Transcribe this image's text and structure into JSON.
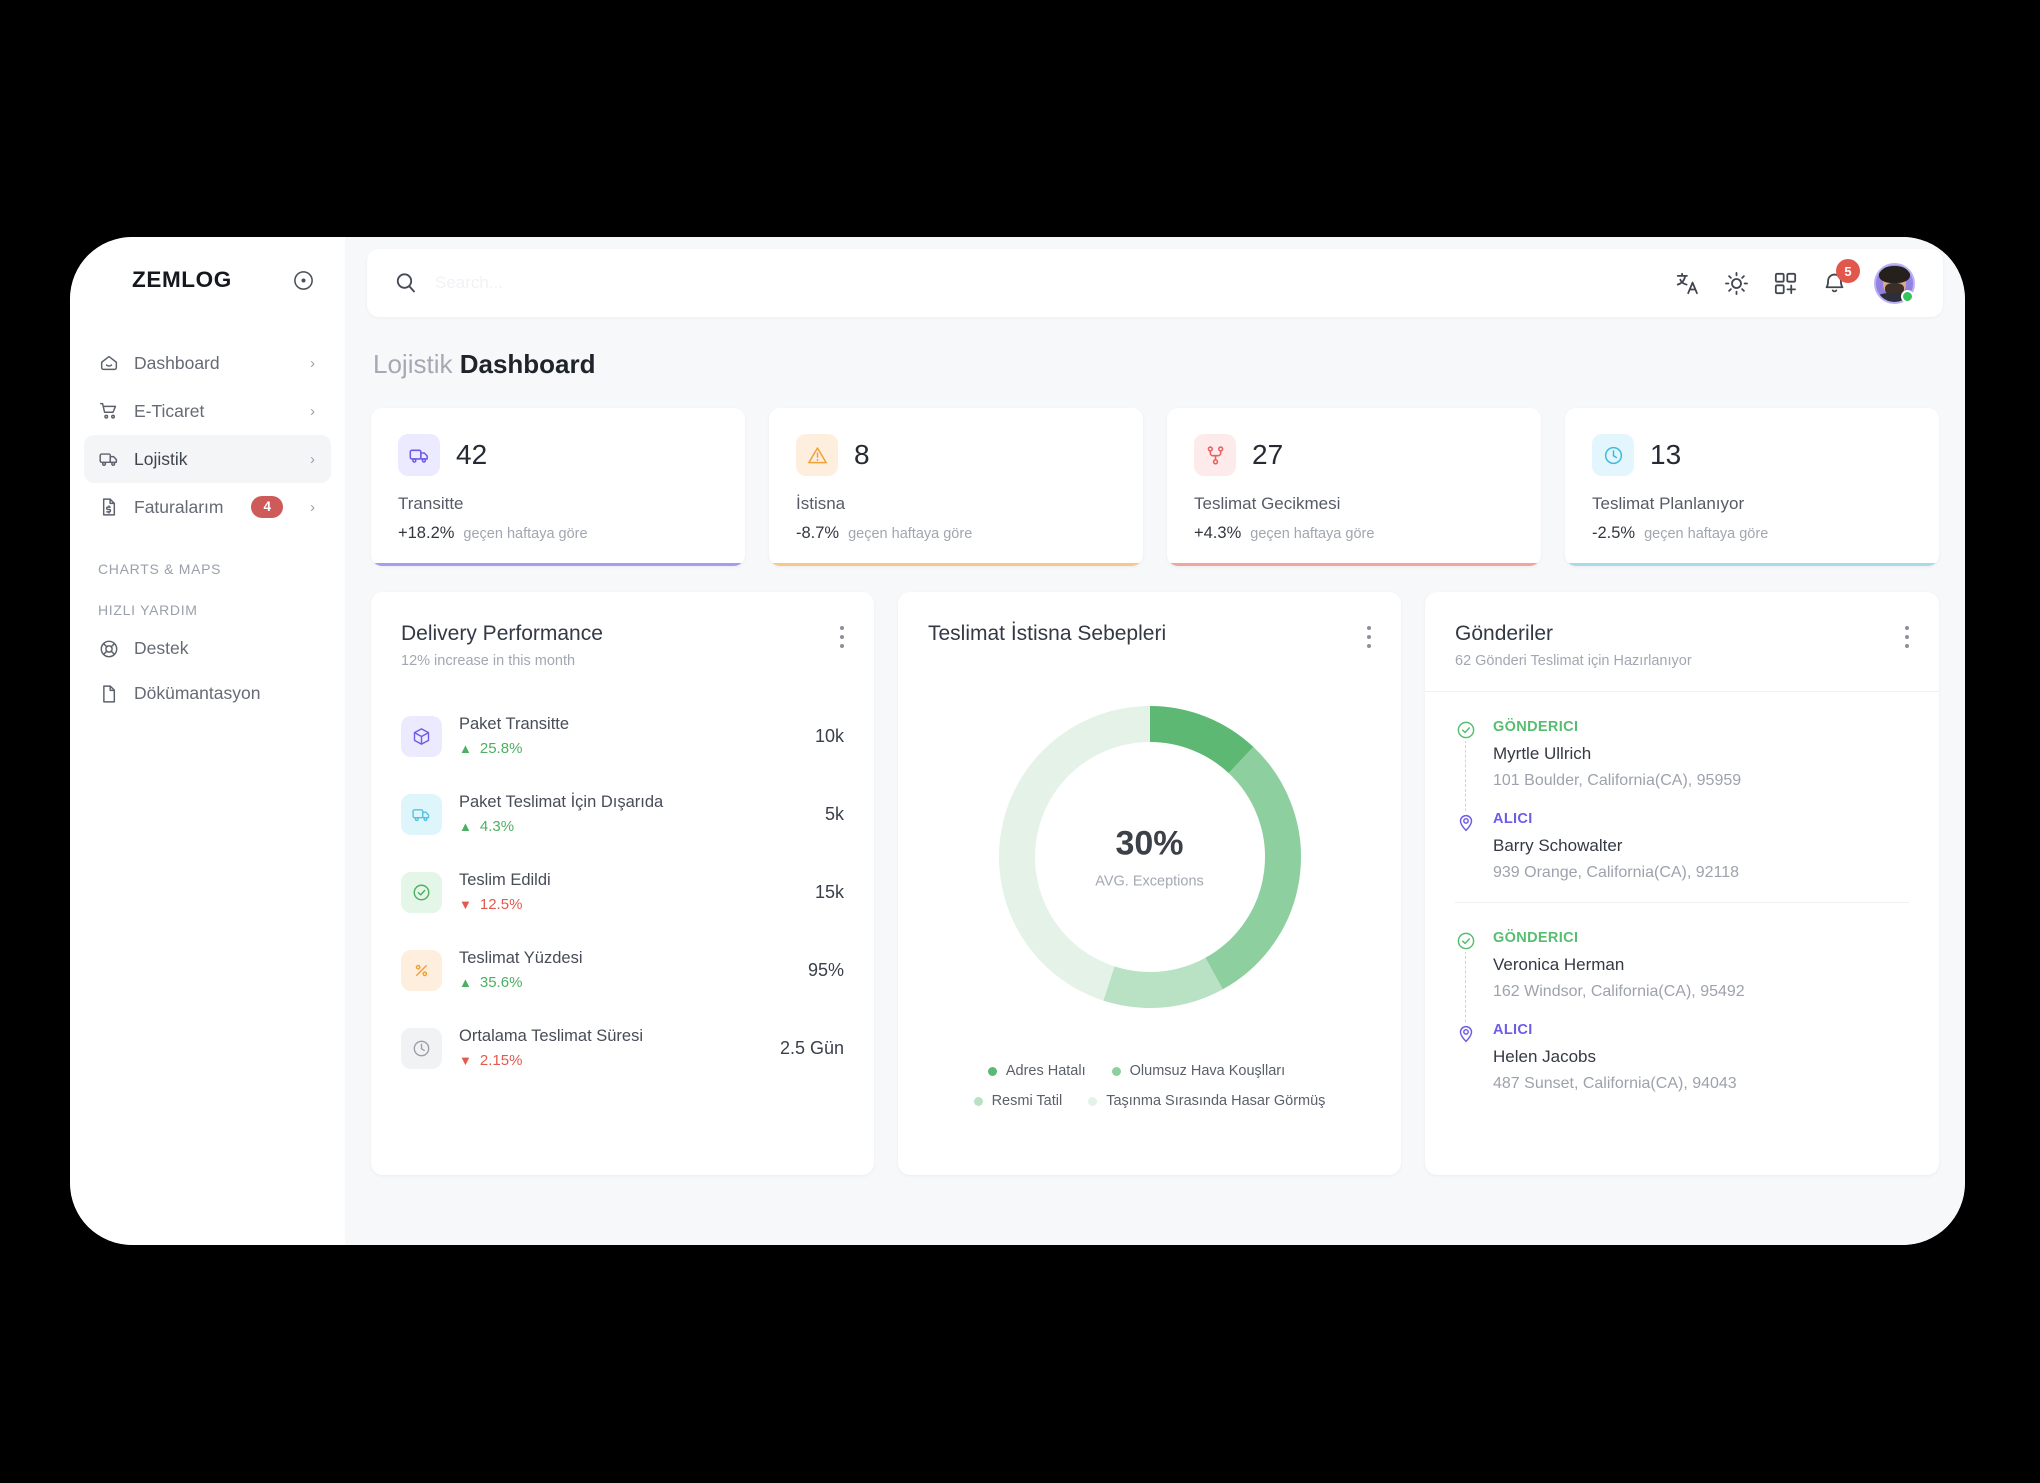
{
  "brand": {
    "name": "ZEMLOG",
    "logo_icon": "target-dot-icon"
  },
  "sidebar": {
    "items": [
      {
        "label": "Dashboard",
        "icon": "home-icon",
        "badge": null,
        "active": false
      },
      {
        "label": "E-Ticaret",
        "icon": "shopping-cart-icon",
        "badge": null,
        "active": false
      },
      {
        "label": "Lojistik",
        "icon": "truck-icon",
        "badge": null,
        "active": true
      },
      {
        "label": "Faturalarım",
        "icon": "invoice-icon",
        "badge": "4",
        "active": false
      }
    ],
    "section_charts": "CHARTS & MAPS",
    "section_help": "HIZLI YARDIM",
    "help_items": [
      {
        "label": "Destek",
        "icon": "lifebuoy-icon"
      },
      {
        "label": "Dökümantasyon",
        "icon": "document-icon"
      }
    ]
  },
  "topbar": {
    "search_placeholder": "Search...",
    "search_value": "",
    "icons": [
      "translate-icon",
      "sun-icon",
      "apps-add-icon",
      "bell-icon"
    ],
    "notification_count": "5",
    "avatar_status": "online"
  },
  "page": {
    "title_muted": "Lojistik",
    "title_strong": "Dashboard"
  },
  "kpi_cards": [
    {
      "value": "42",
      "label": "Transitte",
      "delta": "+18.2%",
      "delta_note": "geçen haftaya göre",
      "icon": "truck-icon",
      "badge_bg": "#eceaff",
      "icon_color": "#6c5ce7",
      "accent": "#a79bf0"
    },
    {
      "value": "8",
      "label": "İstisna",
      "delta": "-8.7%",
      "delta_note": "geçen haftaya göre",
      "icon": "warning-triangle-icon",
      "badge_bg": "#fdeedd",
      "icon_color": "#f0a13c",
      "accent": "#f5c98a"
    },
    {
      "value": "27",
      "label": "Teslimat Gecikmesi",
      "delta": "+4.3%",
      "delta_note": "geçen haftaya göre",
      "icon": "branch-icon",
      "badge_bg": "#fdeaea",
      "icon_color": "#ea5f5f",
      "accent": "#f0a6a0"
    },
    {
      "value": "13",
      "label": "Teslimat Planlanıyor",
      "delta": "-2.5%",
      "delta_note": "geçen haftaya göre",
      "icon": "clock-icon",
      "badge_bg": "#e3f6fd",
      "icon_color": "#42b9de",
      "accent": "#a6dbec"
    }
  ],
  "delivery_performance": {
    "title": "Delivery Performance",
    "subtitle": "12% increase in this month",
    "menu_icon": "kebab-menu-icon",
    "rows": [
      {
        "name": "Paket Transitte",
        "change": "25.8%",
        "direction": "up",
        "value": "10k",
        "icon": "package-icon",
        "badge_bg": "#eceaff",
        "icon_color": "#6c5ce7"
      },
      {
        "name": "Paket Teslimat İçin Dışarıda",
        "change": "4.3%",
        "direction": "up",
        "value": "5k",
        "icon": "truck-icon",
        "badge_bg": "#ddf5fb",
        "icon_color": "#56c2dd"
      },
      {
        "name": "Teslim Edildi",
        "change": "12.5%",
        "direction": "down",
        "value": "15k",
        "icon": "check-circle-icon",
        "badge_bg": "#e4f6e7",
        "icon_color": "#4caf62"
      },
      {
        "name": "Teslimat Yüzdesi",
        "change": "35.6%",
        "direction": "up",
        "value": "95%",
        "icon": "percent-icon",
        "badge_bg": "#fdeedd",
        "icon_color": "#f0a13c"
      },
      {
        "name": "Ortalama Teslimat Süresi",
        "change": "2.15%",
        "direction": "down",
        "value": "2.5 Gün",
        "icon": "clock-icon",
        "badge_bg": "#f1f2f4",
        "icon_color": "#9aa0ab"
      }
    ]
  },
  "chart_data": {
    "type": "pie",
    "title": "Teslimat İstisna Sebepleri",
    "center_value": "30%",
    "center_caption": "AVG. Exceptions",
    "menu_icon": "kebab-menu-icon",
    "categories": [
      "Adres Hatalı",
      "Olumsuz Hava Kouşlları",
      "Resmi Tatil",
      "Taşınma Sırasında Hasar Görmüş"
    ],
    "values": [
      12,
      30,
      13,
      45
    ],
    "colors": [
      "#5cb872",
      "#8ecf9f",
      "#b9e1c4",
      "#e4f2e8"
    ],
    "legend_position": "bottom",
    "grid": false,
    "xlabel": "",
    "ylabel": ""
  },
  "shipments": {
    "title": "Gönderiler",
    "subtitle": "62 Gönderi Teslimat için Hazırlanıyor",
    "menu_icon": "kebab-menu-icon",
    "groups": [
      {
        "sender": {
          "role": "GÖNDERICI",
          "name": "Myrtle Ullrich",
          "address": "101 Boulder, California(CA), 95959",
          "icon": "check-circle-icon"
        },
        "receiver": {
          "role": "ALICI",
          "name": "Barry Schowalter",
          "address": "939 Orange, California(CA), 92118",
          "icon": "map-pin-icon"
        }
      },
      {
        "sender": {
          "role": "GÖNDERICI",
          "name": "Veronica Herman",
          "address": "162 Windsor, California(CA), 95492",
          "icon": "check-circle-icon"
        },
        "receiver": {
          "role": "ALICI",
          "name": "Helen Jacobs",
          "address": "487 Sunset, California(CA), 94043",
          "icon": "map-pin-icon"
        }
      }
    ]
  }
}
